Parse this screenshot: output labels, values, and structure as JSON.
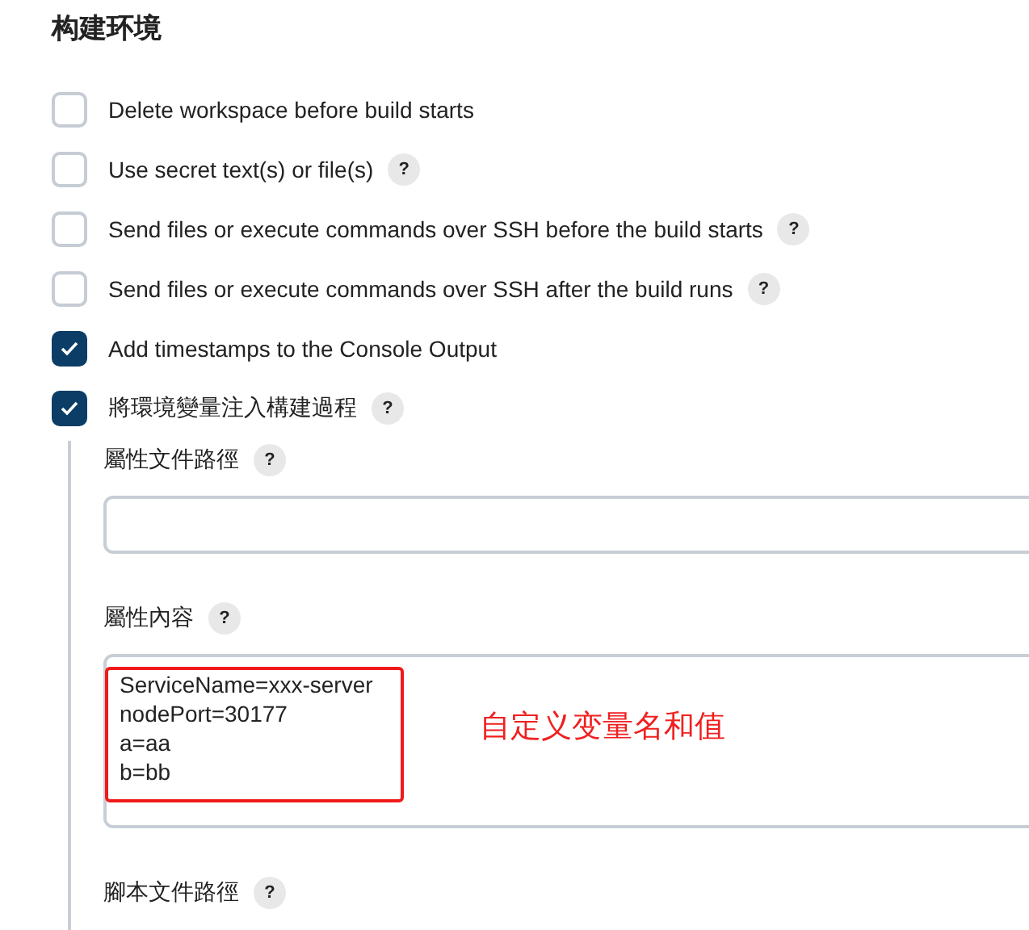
{
  "section_title": "构建环境",
  "options": [
    {
      "label": "Delete workspace before build starts",
      "checked": false,
      "help": false
    },
    {
      "label": "Use secret text(s) or file(s)",
      "checked": false,
      "help": true
    },
    {
      "label": "Send files or execute commands over SSH before the build starts",
      "checked": false,
      "help": true
    },
    {
      "label": "Send files or execute commands over SSH after the build runs",
      "checked": false,
      "help": true
    },
    {
      "label": "Add timestamps to the Console Output",
      "checked": true,
      "help": false
    },
    {
      "label": "將環境變量注入構建過程",
      "checked": true,
      "help": true
    }
  ],
  "help_mark": "?",
  "nested_fields": [
    {
      "kind": "input",
      "label": "屬性文件路徑"
    },
    {
      "kind": "textarea",
      "label": "屬性內容",
      "lines": [
        "ServiceName=xxx-server",
        "nodePort=30177",
        "a=aa",
        "b=bb"
      ],
      "annotation": "自定义变量名和值"
    },
    {
      "kind": "label_only",
      "label": "腳本文件路徑"
    }
  ]
}
